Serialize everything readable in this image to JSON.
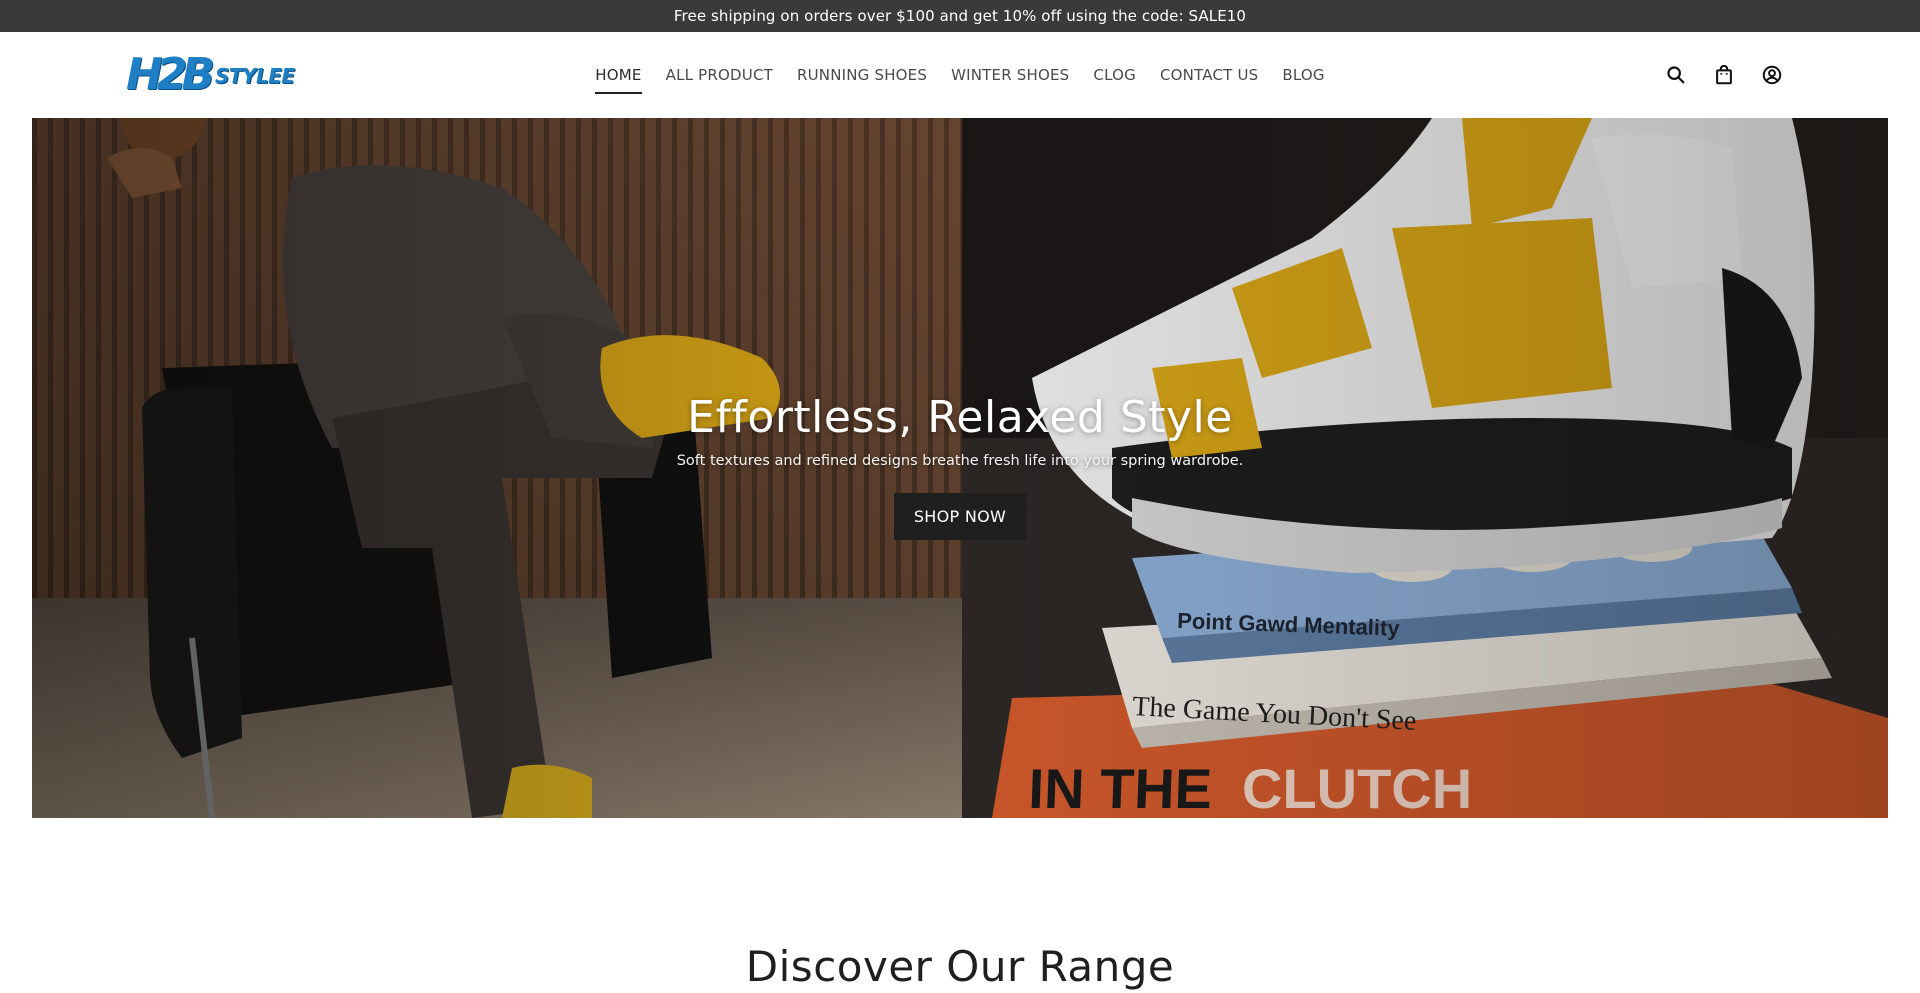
{
  "announcement": {
    "text": "Free shipping on orders over $100 and get 10% off using the code: SALE10"
  },
  "logo": {
    "mark": "H2B",
    "text": "STYLEE"
  },
  "nav": {
    "items": [
      {
        "label": "HOME",
        "active": true
      },
      {
        "label": "ALL PRODUCT"
      },
      {
        "label": "RUNNING SHOES"
      },
      {
        "label": "WINTER SHOES"
      },
      {
        "label": "CLOG"
      },
      {
        "label": "CONTACT US"
      },
      {
        "label": "BLOG"
      }
    ]
  },
  "icons": [
    "search-icon",
    "bag-icon",
    "account-icon"
  ],
  "hero": {
    "title": "Effortless, Relaxed Style",
    "subtitle": "Soft textures and refined designs breathe fresh life into your spring wardrobe.",
    "button": "SHOP NOW",
    "books": [
      "Point Gawd Mentality",
      "The Game You Don't See",
      "IN THE",
      "CLUTCH"
    ]
  },
  "section": {
    "title": "Discover Our Range"
  },
  "colors": {
    "announcement_bg": "#3a3a3a",
    "brand_blue": "#1e7fc4",
    "button_bg": "#1f1f1f",
    "shoe_yellow": "#d9a617"
  }
}
